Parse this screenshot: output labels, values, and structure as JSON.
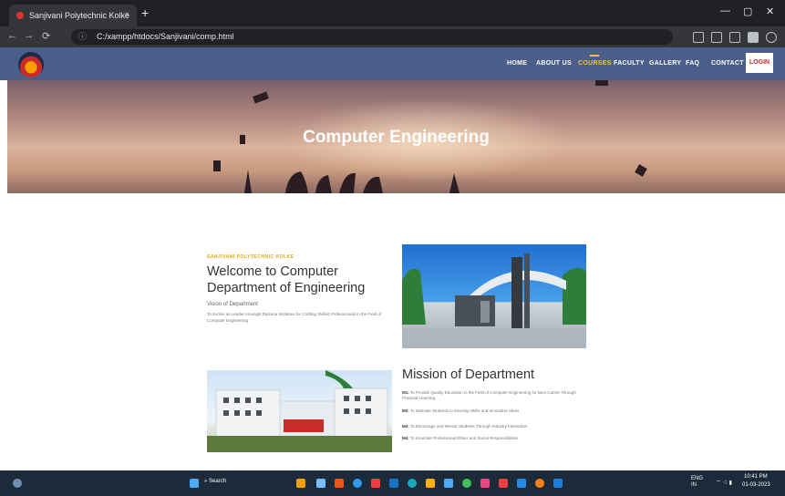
{
  "browser": {
    "tab_title": "Sanjivani Polytechnic Kolke",
    "address": "C:/xampp/htdocs/Sanjivani/comp.html",
    "close_glyph": "×",
    "new_tab_glyph": "+",
    "info_glyph": "ⓘ",
    "window_controls": {
      "minimize": "—",
      "maximize": "▢",
      "close": "✕"
    },
    "nav": {
      "back": "←",
      "forward": "→",
      "reload": "⟳"
    }
  },
  "nav": {
    "items": [
      "HOME",
      "ABOUT US",
      "COURSES",
      "FACULTY",
      "GALLERY",
      "FAQ",
      "CONTACT"
    ],
    "active": "COURSES",
    "login": "LOGIN",
    "bar_color": "#4c5f8a",
    "accent_color": "#f2c14e"
  },
  "hero": {
    "title": "Computer Engineering"
  },
  "welcome": {
    "eyebrow": "SANJIVANI POLYTECHNIC KOLKE",
    "title": "Welcome to Computer Department of Engineering",
    "vision_label": "Vision of Department",
    "vision_text": "To Evolve as Leader Amongst Diploma Institutes for Crafting Skilled Professionals in the Field of Computer Engineering."
  },
  "mission": {
    "title": "Mission of Department",
    "items": [
      {
        "tag": "M1:",
        "text": "To Provide Quality Education in the Field of Computer Engineering for Best Carrier Through Practical Learning."
      },
      {
        "tag": "M2:",
        "text": "To Motivate Students to Develop Skills and Innovative Ideas."
      },
      {
        "tag": "M3:",
        "text": "To Encourage and Mentor Students Through Industry Interaction."
      },
      {
        "tag": "M4:",
        "text": "To Inculcate Professional Ethics and Social Responsibilities."
      }
    ]
  },
  "taskbar": {
    "search": "Search",
    "lang": "ENG IN",
    "time": "10:41 PM",
    "date": "01-03-2023"
  }
}
